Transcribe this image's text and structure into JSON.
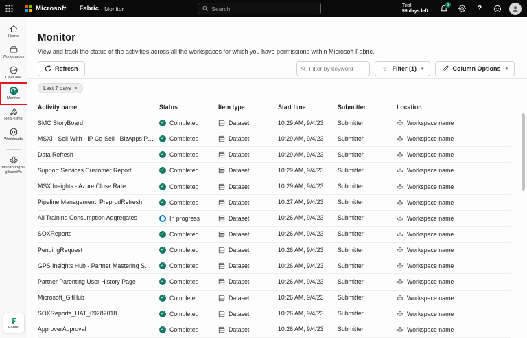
{
  "topbar": {
    "brand": "Microsoft",
    "product": "Fabric",
    "page": "Monitor",
    "search_placeholder": "Search",
    "trial_line1": "Trial:",
    "trial_line2": "59 days left",
    "notification_count": "1"
  },
  "sidebar": {
    "items": [
      {
        "label": "Home"
      },
      {
        "label": "Workspaces"
      },
      {
        "label": "OneLake"
      },
      {
        "label": "Monitor",
        "selected": true
      },
      {
        "label": "Real-Time"
      },
      {
        "label": "Workloads"
      },
      {
        "label": "MonitoringBugBashWs"
      }
    ],
    "footer_label": "Fabric"
  },
  "page": {
    "title": "Monitor",
    "description": "View and track the status of the activities across all the workspaces for which you have permissions within Microsoft Fabric.",
    "refresh_label": "Refresh",
    "keyword_placeholder": "Filter by keyword",
    "filter_label": "Filter (1)",
    "column_options_label": "Column Options",
    "active_filter_chip": "Last 7 days"
  },
  "table": {
    "columns": [
      "Activity name",
      "Status",
      "Item type",
      "Start time",
      "Submitter",
      "Location"
    ],
    "rows": [
      {
        "name": "SMC StoryBoard",
        "status": "Completed",
        "item_type": "Dataset",
        "start_time": "10:29 AM, 9/4/23",
        "submitter": "Submitter",
        "location": "Workspace name"
      },
      {
        "name": "MSXI - Sell-With - IP Co-Sell - BizApps Performa...",
        "status": "Completed",
        "item_type": "Dataset",
        "start_time": "10:29 AM, 9/4/23",
        "submitter": "Submitter",
        "location": "Workspace name"
      },
      {
        "name": "Data Refresh",
        "status": "Completed",
        "item_type": "Dataset",
        "start_time": "10:29 AM, 9/4/23",
        "submitter": "Submitter",
        "location": "Workspace name"
      },
      {
        "name": "Support Services Customer Report",
        "status": "Completed",
        "item_type": "Dataset",
        "start_time": "10:29 AM, 9/4/23",
        "submitter": "Submitter",
        "location": "Workspace name"
      },
      {
        "name": "MSX Insights - Azure Close Rate",
        "status": "Completed",
        "item_type": "Dataset",
        "start_time": "10:29 AM, 9/4/23",
        "submitter": "Submitter",
        "location": "Workspace name"
      },
      {
        "name": "Pipeline Management_PreprodRefresh",
        "status": "Completed",
        "item_type": "Dataset",
        "start_time": "10:27 AM, 9/4/23",
        "submitter": "Submitter",
        "location": "Workspace name"
      },
      {
        "name": "All Training Consumption Aggregates",
        "status": "In progress",
        "item_type": "Dataset",
        "start_time": "10:26 AM, 9/4/23",
        "submitter": "Submitter",
        "location": "Workspace name"
      },
      {
        "name": "SOXReports",
        "status": "Completed",
        "item_type": "Dataset",
        "start_time": "10:26 AM, 9/4/23",
        "submitter": "Submitter",
        "location": "Workspace name"
      },
      {
        "name": "PendingRequest",
        "status": "Completed",
        "item_type": "Dataset",
        "start_time": "10:26 AM, 9/4/23",
        "submitter": "Submitter",
        "location": "Workspace name"
      },
      {
        "name": "GPS Insights Hub - Partner Mastering Search",
        "status": "Completed",
        "item_type": "Dataset",
        "start_time": "10:26 AM, 9/4/23",
        "submitter": "Submitter",
        "location": "Workspace name"
      },
      {
        "name": "Partner Parenting User History Page",
        "status": "Completed",
        "item_type": "Dataset",
        "start_time": "10:26 AM, 9/4/23",
        "submitter": "Submitter",
        "location": "Workspace name"
      },
      {
        "name": "Microsoft_GitHub",
        "status": "Completed",
        "item_type": "Dataset",
        "start_time": "10:26 AM, 9/4/23",
        "submitter": "Submitter",
        "location": "Workspace name"
      },
      {
        "name": "SOXReports_UAT_09282018",
        "status": "Completed",
        "item_type": "Dataset",
        "start_time": "10:26 AM, 9/4/23",
        "submitter": "Submitter",
        "location": "Workspace name"
      },
      {
        "name": "ApproverApproval",
        "status": "Completed",
        "item_type": "Dataset",
        "start_time": "10:26 AM, 9/4/23",
        "submitter": "Submitter",
        "location": "Workspace name"
      }
    ]
  },
  "colors": {
    "status_completed": "#117865",
    "status_in_progress": "#0078d4",
    "selected_highlight": "#e81123",
    "notification_badge": "#0e7a5a",
    "topbar_bg": "#0a0a0a",
    "ms_logo": [
      "#f25022",
      "#7fba00",
      "#00a4ef",
      "#ffb900"
    ]
  }
}
